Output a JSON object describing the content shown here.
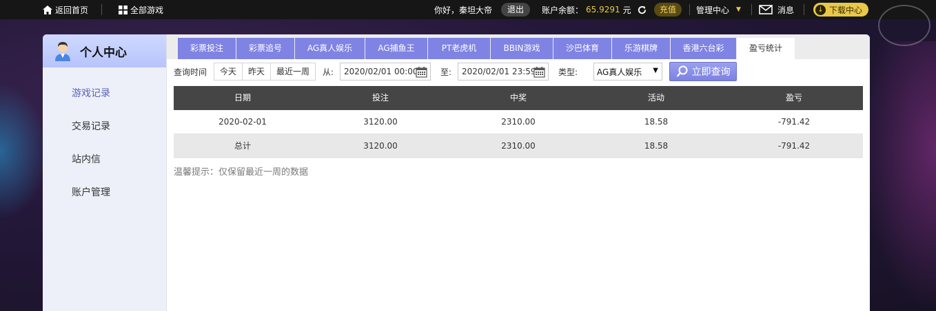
{
  "topbar": {
    "home_label": "返回首页",
    "all_games_label": "全部游戏",
    "greeting": "你好，秦坦大帝",
    "logout_label": "退出",
    "balance_label": "账户余额：",
    "balance_value": "65.9291",
    "balance_unit": "元",
    "recharge_label": "充值",
    "manage_label": "管理中心",
    "message_label": "消息",
    "download_label": "下载中心"
  },
  "sidebar": {
    "title": "个人中心",
    "items": [
      {
        "label": "游戏记录"
      },
      {
        "label": "交易记录"
      },
      {
        "label": "站内信"
      },
      {
        "label": "账户管理"
      }
    ]
  },
  "tabs": [
    {
      "label": "彩票投注"
    },
    {
      "label": "彩票追号"
    },
    {
      "label": "AG真人娱乐"
    },
    {
      "label": "AG捕鱼王"
    },
    {
      "label": "PT老虎机"
    },
    {
      "label": "BBIN游戏"
    },
    {
      "label": "沙巴体育"
    },
    {
      "label": "乐游棋牌"
    },
    {
      "label": "香港六台彩"
    },
    {
      "label": "盈亏统计"
    }
  ],
  "filter": {
    "query_time_label": "查询时间",
    "quick": [
      "今天",
      "昨天",
      "最近一周"
    ],
    "from_label": "从:",
    "from_value": "2020/02/01 00:00",
    "to_label": "至:",
    "to_value": "2020/02/01 23:59",
    "type_label": "类型:",
    "type_value": "AG真人娱乐",
    "query_button": "立即查询"
  },
  "table": {
    "headers": [
      "日期",
      "投注",
      "中奖",
      "活动",
      "盈亏"
    ],
    "rows": [
      [
        "2020-02-01",
        "3120.00",
        "2310.00",
        "18.58",
        "-791.42"
      ],
      [
        "总计",
        "3120.00",
        "2310.00",
        "18.58",
        "-791.42"
      ]
    ]
  },
  "tip": "温馨提示：仅保留最近一周的数据",
  "colors": {
    "accent": "#7f83e4",
    "balance": "#e8c94a",
    "table_header": "#454545"
  }
}
